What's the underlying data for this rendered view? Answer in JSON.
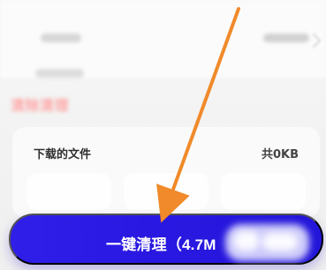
{
  "top_list": {
    "left_item_1": "",
    "right_item_1": "",
    "left_item_2": ""
  },
  "section": {
    "title": "清除清理"
  },
  "downloads": {
    "label": "下载的文件",
    "size": "共0KB"
  },
  "cta": {
    "label": "一键清理（4.7M"
  },
  "colors": {
    "cta_blue": "#2a1ae6",
    "arrow_orange": "#f08a2a",
    "section_red_blur": "#ff9f9f"
  },
  "icons": {
    "chevron": "chevron-right-icon",
    "arrow": "arrow-annotation-icon"
  }
}
